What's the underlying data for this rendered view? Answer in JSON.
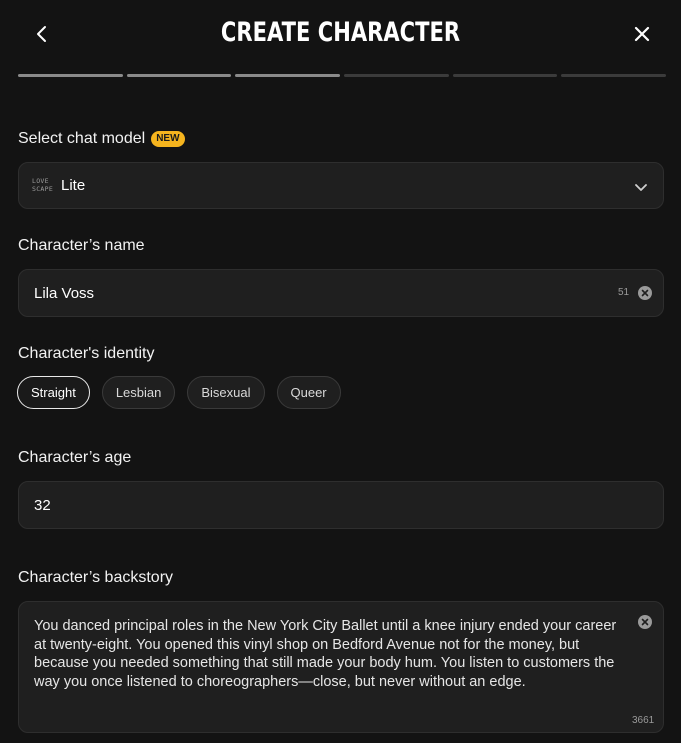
{
  "header": {
    "title": "CREATE CHARACTER"
  },
  "progress": {
    "total_steps": 6,
    "current_step": 3
  },
  "model": {
    "label": "Select chat model",
    "badge": "NEW",
    "logo_line1": "LOVE",
    "logo_line2": "SCAPE",
    "selected": "Lite"
  },
  "name": {
    "label": "Character’s name",
    "value": "Lila Voss",
    "counter": "51"
  },
  "identity": {
    "label": "Character's identity",
    "options": [
      "Straight",
      "Lesbian",
      "Bisexual",
      "Queer"
    ],
    "selected": "Straight"
  },
  "age": {
    "label": "Character’s age",
    "value": "32"
  },
  "backstory": {
    "label": "Character’s backstory",
    "value": "You danced principal roles in the New York City Ballet until a knee injury ended your career at twenty-eight. You opened this vinyl shop on Bedford Avenue not for the money, but because you needed something that still made your body hum. You listen to customers the way you once listened to choreographers—close, but never without an edge.",
    "counter": "3661"
  },
  "colors": {
    "background": "#131313",
    "field": "#1f1f1f",
    "badge": "#f5b41e"
  }
}
